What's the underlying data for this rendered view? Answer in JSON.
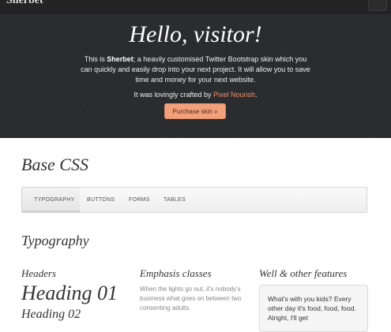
{
  "navbar": {
    "brand": "Sherbet"
  },
  "hero": {
    "title": "Hello, visitor!",
    "desc_prefix": "This is ",
    "desc_brand": "Sherbet",
    "desc_rest": "; a heavily customised Twitter Bootstrap skin which you can quickly and easily drop into your next project. It will allow you to save time and money for your next website.",
    "credit_prefix": "It was lovingly crafted by ",
    "credit_link": "Pixel Nourish",
    "credit_suffix": ".",
    "button_label": "Purchase skin »",
    "accent_color": "#f2a07c"
  },
  "main": {
    "section_title": "Base CSS",
    "tabs": [
      {
        "label": "Typography",
        "active": true
      },
      {
        "label": "Buttons",
        "active": false
      },
      {
        "label": "Forms",
        "active": false
      },
      {
        "label": "Tables",
        "active": false
      }
    ],
    "subsection_title": "Typography",
    "columns": {
      "headers_title": "Headers",
      "heading_01": "Heading 01",
      "heading_02": "Heading 02",
      "emphasis_title": "Emphasis classes",
      "emphasis_text": "When the lights go out, it's nobody's business what goes on between two consenting adults.",
      "well_title": "Well & other features",
      "well_text": "What's with you kids? Every other day it's food, food, food. Alright, I'll get"
    }
  }
}
